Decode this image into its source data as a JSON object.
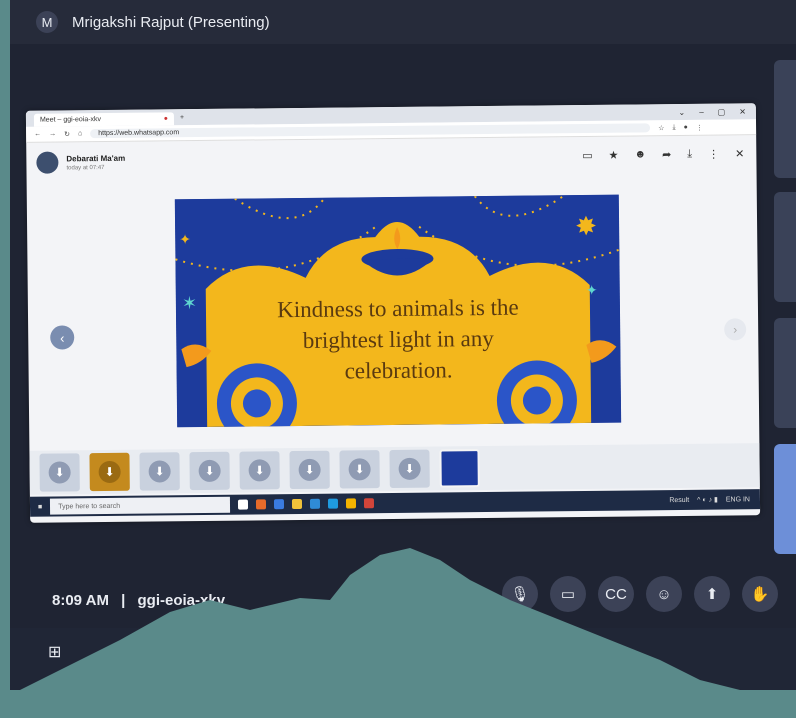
{
  "meet": {
    "presenter_initial": "M",
    "presenter_label": "Mrigakshi Rajput (Presenting)",
    "time": "8:09 AM",
    "separator": "|",
    "meeting_code": "ggi-eoia-xkv"
  },
  "browser": {
    "tab_title": "Meet – ggi-eoia-xkv",
    "url": "https://web.whatsapp.com"
  },
  "whatsapp": {
    "sender": "Debarati Ma'am",
    "timestamp": "today at 07:47"
  },
  "slide": {
    "line1": "Kindness to animals is the",
    "line2": "brightest light in any",
    "line3": "celebration."
  },
  "taskbar": {
    "search_placeholder": "Type here to search",
    "result_label": "Result",
    "lang": "ENG IN"
  },
  "colors": {
    "slide_blue": "#1d3b9c",
    "slide_yellow": "#f3b71c",
    "meet_bg": "#1f2433",
    "teal": "#5a8a8a"
  }
}
